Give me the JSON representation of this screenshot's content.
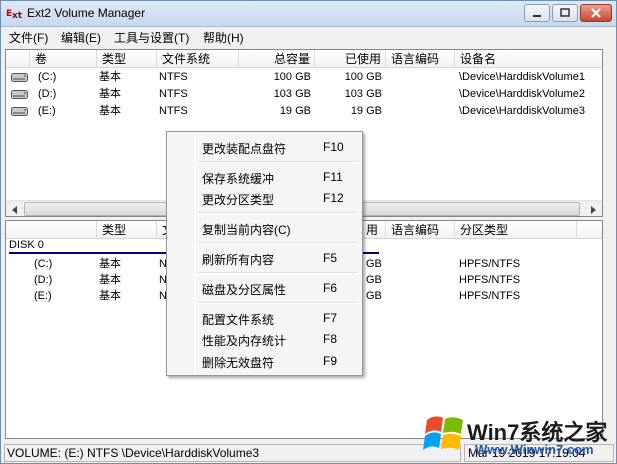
{
  "window": {
    "title": "Ext2 Volume Manager"
  },
  "menu": [
    "文件(F)",
    "编辑(E)",
    "工具与设置(T)",
    "帮助(H)"
  ],
  "volumes_table": {
    "headers": [
      "卷",
      "类型",
      "文件系统",
      "总容量",
      "已使用",
      "语言编码",
      "设备名"
    ],
    "rows": [
      {
        "volume": "(C:)",
        "type": "基本",
        "fs": "NTFS",
        "total": "100 GB",
        "used": "100 GB",
        "codepage": "",
        "device": "\\Device\\HarddiskVolume1"
      },
      {
        "volume": "(D:)",
        "type": "基本",
        "fs": "NTFS",
        "total": "103 GB",
        "used": "103 GB",
        "codepage": "",
        "device": "\\Device\\HarddiskVolume2"
      },
      {
        "volume": "(E:)",
        "type": "基本",
        "fs": "NTFS",
        "total": "19 GB",
        "used": "19 GB",
        "codepage": "",
        "device": "\\Device\\HarddiskVolume3"
      }
    ]
  },
  "partitions_table": {
    "headers": [
      "",
      "类型",
      "文",
      "用",
      "语言编码",
      "分区类型"
    ],
    "disk_label": "DISK 0",
    "rows": [
      {
        "volume": "(C:)",
        "type": "基本",
        "fs": "N",
        "used": "GB",
        "part_type": "HPFS/NTFS"
      },
      {
        "volume": "(D:)",
        "type": "基本",
        "fs": "N",
        "used": "GB",
        "part_type": "HPFS/NTFS"
      },
      {
        "volume": "(E:)",
        "type": "基本",
        "fs": "N",
        "used": "GB",
        "part_type": "HPFS/NTFS"
      }
    ]
  },
  "context_menu": {
    "items": [
      {
        "label": "更改装配点盘符",
        "key": "F10"
      },
      {
        "label": "保存系统缓冲",
        "key": "F11"
      },
      {
        "label": "更改分区类型",
        "key": "F12"
      },
      {
        "label": "复制当前内容(C)",
        "key": ""
      },
      {
        "label": "刷新所有内容",
        "key": "F5"
      },
      {
        "label": "磁盘及分区属性",
        "key": "F6"
      },
      {
        "label": "配置文件系统",
        "key": "F7"
      },
      {
        "label": "性能及内存统计",
        "key": "F8"
      },
      {
        "label": "删除无效盘符",
        "key": "F9"
      }
    ]
  },
  "status": {
    "left": "VOLUME: (E:) NTFS \\Device\\HarddiskVolume3",
    "right": "Mar 19 2019 17:19:04"
  },
  "watermark": {
    "text": "Win7系统之家",
    "url": "Www.Winwin7.com"
  },
  "colors": {
    "disk_line": "#000080",
    "title_gradient_top": "#dfe9f5",
    "close_button": "#c7452d"
  },
  "icons": [
    "app-icon",
    "minimize-icon",
    "maximize-icon",
    "close-icon",
    "drive-icon",
    "scroll-left-icon",
    "scroll-right-icon",
    "windows-logo-icon"
  ]
}
